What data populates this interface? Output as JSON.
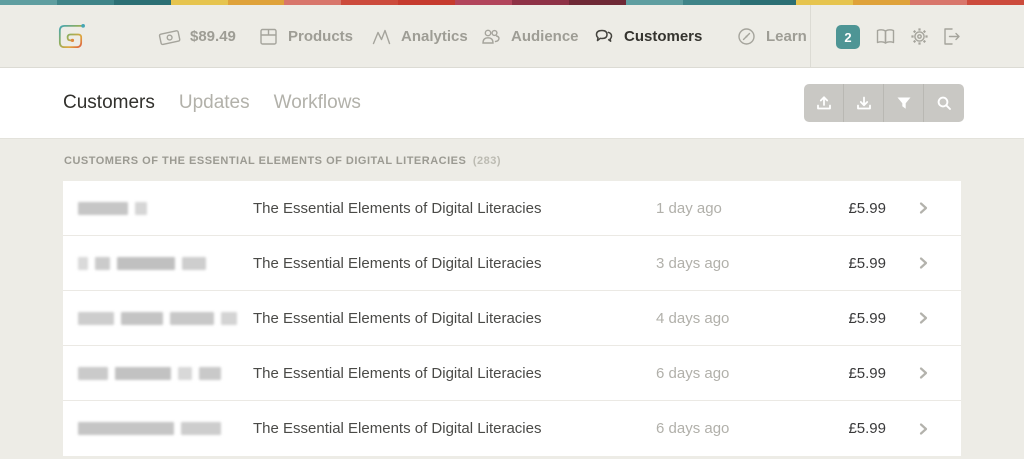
{
  "stripe": {
    "segments": 18,
    "colors": [
      "#5f9ea0",
      "#3f8488",
      "#2c6f74",
      "#e6c44e",
      "#dfa23a",
      "#d8766b",
      "#cc4b3c",
      "#c63b2e",
      "#b2455c",
      "#8e3246",
      "#6f2936"
    ]
  },
  "nav": {
    "balance": {
      "label": "$89.49",
      "icon": "banknote-icon"
    },
    "items": [
      {
        "label": "Products",
        "icon": "box-icon",
        "active": false
      },
      {
        "label": "Analytics",
        "icon": "peaks-icon",
        "active": false
      },
      {
        "label": "Audience",
        "icon": "people-icon",
        "active": false
      },
      {
        "label": "Customers",
        "icon": "chat-bubbles-icon",
        "active": true
      },
      {
        "label": "Learn",
        "icon": "compass-icon",
        "active": false
      }
    ],
    "badge": {
      "count": "2",
      "color": "#4e9595"
    },
    "icon_buttons": [
      "book-icon",
      "gear-icon",
      "sign-out-icon"
    ]
  },
  "tabs": [
    {
      "label": "Customers",
      "active": true
    },
    {
      "label": "Updates",
      "active": false
    },
    {
      "label": "Workflows",
      "active": false
    }
  ],
  "toolbar": {
    "buttons": [
      "upload-icon",
      "download-icon",
      "filter-icon",
      "search-icon"
    ]
  },
  "section": {
    "title": "CUSTOMERS OF THE ESSENTIAL ELEMENTS OF DIGITAL LITERACIES",
    "count": "(283)"
  },
  "table": {
    "rows": [
      {
        "product": "The Essential Elements of Digital Literacies",
        "time": "1 day ago",
        "price": "£5.99",
        "redacted_blocks": [
          [
            50,
            "#c6c6c6"
          ],
          [
            12,
            "#d6d6d6"
          ]
        ]
      },
      {
        "product": "The Essential Elements of Digital Literacies",
        "time": "3 days ago",
        "price": "£5.99",
        "redacted_blocks": [
          [
            10,
            "#dadada"
          ],
          [
            15,
            "#cbcbcb"
          ],
          [
            58,
            "#c0c0c0"
          ],
          [
            24,
            "#cecece"
          ]
        ]
      },
      {
        "product": "The Essential Elements of Digital Literacies",
        "time": "4 days ago",
        "price": "£5.99",
        "redacted_blocks": [
          [
            36,
            "#cdcdcd"
          ],
          [
            42,
            "#c4c4c4"
          ],
          [
            44,
            "#c8c8c8"
          ],
          [
            16,
            "#d4d4d4"
          ]
        ]
      },
      {
        "product": "The Essential Elements of Digital Literacies",
        "time": "6 days ago",
        "price": "£5.99",
        "redacted_blocks": [
          [
            30,
            "#cacaca"
          ],
          [
            56,
            "#c2c2c2"
          ],
          [
            14,
            "#d8d8d8"
          ],
          [
            22,
            "#c9c9c9"
          ]
        ]
      },
      {
        "product": "The Essential Elements of Digital Literacies",
        "time": "6 days ago",
        "price": "£5.99",
        "redacted_blocks": [
          [
            96,
            "#c5c5c5"
          ],
          [
            40,
            "#cdcdcd"
          ]
        ]
      }
    ]
  }
}
